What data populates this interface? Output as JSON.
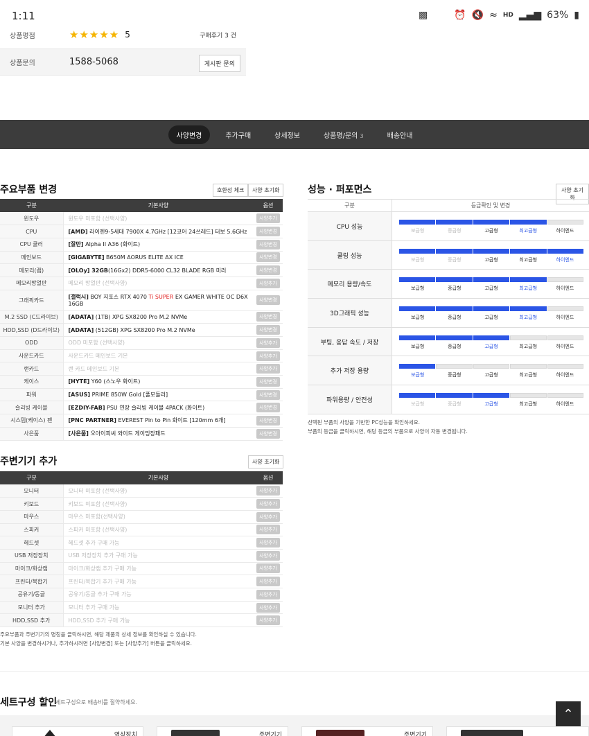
{
  "status_bar": {
    "time": "1:11",
    "battery": "63%",
    "left_icon": "clipboard-icon",
    "icons": [
      "alarm-icon",
      "mute-icon",
      "wifi-icon",
      "hd-voice-icon",
      "signal-icon",
      "battery-icon"
    ],
    "hd_label": "HD"
  },
  "product_info": {
    "rating_label": "상품평점",
    "stars": "★★★★★",
    "rating_value": "5",
    "review_count": "구매후기 3 건",
    "inquiry_label": "상품문의",
    "phone": "1588-5068",
    "inquiry_button": "게시판 문의"
  },
  "tabs": [
    {
      "label": "사양변경",
      "active": true,
      "badge": ""
    },
    {
      "label": "추가구매",
      "active": false,
      "badge": ""
    },
    {
      "label": "상세정보",
      "active": false,
      "badge": ""
    },
    {
      "label": "상품평/문의",
      "active": false,
      "badge": "3"
    },
    {
      "label": "배송안내",
      "active": false,
      "badge": ""
    }
  ],
  "main_parts": {
    "title": "주요부품 변경",
    "btn_compat": "호환성 체크",
    "btn_reset": "사양 초기화",
    "headers": [
      "구분",
      "기본사양",
      "옵션"
    ],
    "rows": [
      {
        "cat": "윈도우",
        "brand": "",
        "val": "윈도우 미포함 (선택사양)",
        "opt": "사양추가",
        "muted": true
      },
      {
        "cat": "CPU",
        "brand": "[AMD]",
        "val": " 라이젠9-5세대 7900X 4.7GHz [12코어 24쓰레드] 터보 5.6GHz",
        "opt": "사양변경",
        "muted": false
      },
      {
        "cat": "CPU 쿨러",
        "brand": "[잘만]",
        "val": " Alpha II A36 (화이트)",
        "opt": "사양변경",
        "muted": false
      },
      {
        "cat": "메인보드",
        "brand": "[GIGABYTE]",
        "val": " B650M AORUS ELITE AX ICE",
        "opt": "사양변경",
        "muted": false
      },
      {
        "cat": "메모리(램)",
        "brand": "[OLOy] 32GB",
        "val": "(16Gx2) DDR5-6000 CL32 BLADE RGB 미러",
        "opt": "사양변경",
        "muted": false
      },
      {
        "cat": "메모리방열판",
        "brand": "",
        "val": "메모리 방열판 (선택사양)",
        "opt": "사양추가",
        "muted": true
      },
      {
        "cat": "그래픽카드",
        "brand": "[갤럭시]",
        "val": " BOY 지포스 RTX 4070 ",
        "val_red": "Ti SUPER",
        "val_tail": " EX GAMER WHITE OC D6X 16GB",
        "opt": "사양변경",
        "muted": false
      },
      {
        "cat": "M.2 SSD (C드라이브)",
        "brand": "[ADATA]",
        "val": " (1TB) XPG SX8200 Pro M.2 NVMe",
        "opt": "사양변경",
        "muted": false
      },
      {
        "cat": "HDD,SSD (D드라이브)",
        "brand": "[ADATA]",
        "val": " (512GB) XPG SX8200 Pro M.2 NVMe",
        "opt": "사양변경",
        "muted": false
      },
      {
        "cat": "ODD",
        "brand": "",
        "val": "ODD 미포함 (선택사양)",
        "opt": "사양추가",
        "muted": true
      },
      {
        "cat": "사운드카드",
        "brand": "",
        "val": "사운드카드 메인보드 기본",
        "opt": "사양추가",
        "muted": true
      },
      {
        "cat": "랜카드",
        "brand": "",
        "val": "랜 카드 메인보드 기본",
        "opt": "사양추가",
        "muted": true
      },
      {
        "cat": "케이스",
        "brand": "[HYTE]",
        "val": " Y60 (스노우 화이트)",
        "opt": "사양변경",
        "muted": false
      },
      {
        "cat": "파워",
        "brand": "[ASUS]",
        "val": " PRIME 850W Gold [풀모듈러]",
        "opt": "사양변경",
        "muted": false
      },
      {
        "cat": "슬리빙 케이블",
        "brand": "[EZDIY-FAB]",
        "val": " PSU 연장 슬리빙 케이블 4PACK (화이트)",
        "opt": "사양변경",
        "muted": false
      },
      {
        "cat": "시스템(케이스) 팬",
        "brand": "[PNC PARTNER]",
        "val": " EVEREST Pin to Pin 화이트 [120mm 6개]",
        "opt": "사양변경",
        "muted": false
      },
      {
        "cat": "사은품",
        "brand": "[사은품]",
        "val": " 오아이피씨 와이드 게이밍장패드",
        "opt": "사양변경",
        "muted": false
      }
    ]
  },
  "peripherals": {
    "title": "주변기기 추가",
    "btn_reset": "사양 초기화",
    "headers": [
      "구분",
      "기본사양",
      "옵션"
    ],
    "rows": [
      {
        "cat": "모니터",
        "val": "모니터 미포함 (선택사양)",
        "opt": "사양추가"
      },
      {
        "cat": "키보드",
        "val": "키보드 미포함 (선택사양)",
        "opt": "사양추가"
      },
      {
        "cat": "마우스",
        "val": "마우스 미포함(선택사양)",
        "opt": "사양추가"
      },
      {
        "cat": "스피커",
        "val": "스피커 미포함 (선택사양)",
        "opt": "사양추가"
      },
      {
        "cat": "헤드셋",
        "val": "헤드셋 추가 구매 가능",
        "opt": "사양추가"
      },
      {
        "cat": "USB 저장장치",
        "val": "USB 저장장치 추가 구매 가능",
        "opt": "사양추가"
      },
      {
        "cat": "마이크/화상캠",
        "val": "마이크/화상캠 추가 구매 가능",
        "opt": "사양추가"
      },
      {
        "cat": "프린터/복합기",
        "val": "프린터/복합기 추가 구매 가능",
        "opt": "사양추가"
      },
      {
        "cat": "공유기/동글",
        "val": "공유기/동글 추가 구매 가능",
        "opt": "사양추가"
      },
      {
        "cat": "모니터 추가",
        "val": "모니터 추가 구매 가능",
        "opt": "사양추가"
      },
      {
        "cat": "HDD,SSD 추가",
        "val": "HDD,SSD 추가 구매 가능",
        "opt": "사양추가"
      }
    ],
    "note_line1": "주요부품과 주변기기의 명칭을 클릭하시면, 해당 제품의 상세 정보를 확인하실 수 있습니다.",
    "note_line2": "기본 사양을 변경하시거나, 추가하시려면 [사양변경] 또는 [사양추가] 버튼을 클릭하세요."
  },
  "performance": {
    "title": "성능 · 퍼포먼스",
    "btn_reset": "사양 초기화",
    "headers": [
      "구분",
      "등급확인 및 변경"
    ],
    "levels": [
      "보급형",
      "중급형",
      "고급형",
      "최고급형",
      "하이엔드"
    ],
    "rows": [
      {
        "label": "CPU 성능",
        "level": 4
      },
      {
        "label": "쿨링 성능",
        "level": 5
      },
      {
        "label": "메모리 용량/속도",
        "level": 4
      },
      {
        "label": "3D그래픽 성능",
        "level": 4
      },
      {
        "label": "부팅, 응답 속도 / 저장",
        "level": 3
      },
      {
        "label": "추가 저장 용량",
        "level": 1
      },
      {
        "label": "파워용량 / 안전성",
        "level": 3
      }
    ],
    "note_line1": "선택된 부품의 사양을 기반한 PC성능을 확인하세요.",
    "note_line2": "부품의 등급을 클릭하시면, 해당 등급의 부품으로 사양이 자동 변경됩니다."
  },
  "set_discount": {
    "title": "세트구성 할인",
    "subtitle": "세트구성으로 배송비를 절약하세요.",
    "cards": [
      "영상장치",
      "주변기기",
      "주변기기"
    ]
  },
  "colors": {
    "accent": "#2b55e6",
    "dark_bar": "#3c3c3c",
    "star": "#f5b400",
    "highlight_red": "#e02020"
  }
}
